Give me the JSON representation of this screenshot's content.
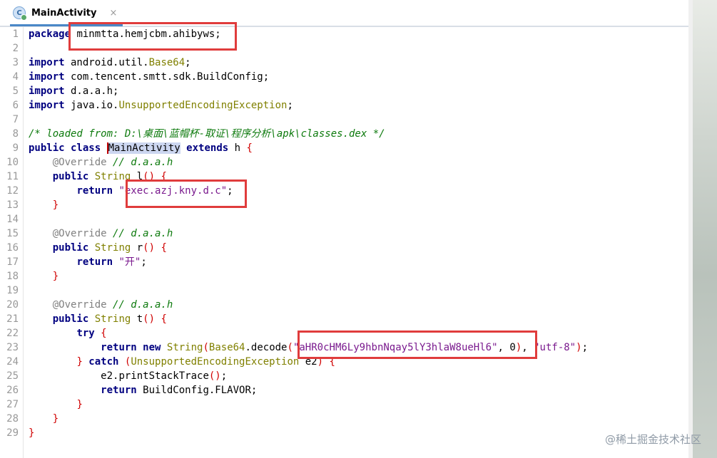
{
  "tab": {
    "icon": "class-c-icon",
    "title": "MainActivity",
    "close": "×"
  },
  "line_numbers": [
    "1",
    "2",
    "3",
    "4",
    "5",
    "6",
    "7",
    "8",
    "9",
    "10",
    "11",
    "12",
    "13",
    "14",
    "15",
    "16",
    "17",
    "18",
    "19",
    "20",
    "21",
    "22",
    "23",
    "24",
    "25",
    "26",
    "27",
    "28",
    "29"
  ],
  "code": {
    "l1": {
      "kw": "package",
      "rest": " minmtta.hemjcbm.ahibyws;"
    },
    "l3": {
      "kw": "import",
      "pkg": " android.util.",
      "cls": "Base64",
      "end": ";"
    },
    "l4": {
      "kw": "import",
      "rest": " com.tencent.smtt.sdk.BuildConfig;"
    },
    "l5": {
      "kw": "import",
      "rest": " d.a.a.h;"
    },
    "l6": {
      "kw": "import",
      "pkg": " java.io.",
      "cls": "UnsupportedEncodingException",
      "end": ";"
    },
    "l8": {
      "comment": "/* loaded from: D:\\桌面\\蓝帽杯-取证\\程序分析\\apk\\classes.dex */"
    },
    "l9": {
      "kw1": "public",
      "kw2": " class ",
      "name": "MainActivity",
      "kw3": " extends",
      "rest": " h ",
      "brace": "{"
    },
    "l10": {
      "ann": "@Override",
      "comment": " // d.a.a.h"
    },
    "l11": {
      "kw": "public",
      "type": " String",
      "name": " l",
      "paren": "()",
      "brace": " {"
    },
    "l12": {
      "kw": "return",
      "str": " \"exec.azj.kny.d.c\"",
      "end": ";"
    },
    "l13": {
      "brace": "}"
    },
    "l15": {
      "ann": "@Override",
      "comment": " // d.a.a.h"
    },
    "l16": {
      "kw": "public",
      "type": " String",
      "name": " r",
      "paren": "()",
      "brace": " {"
    },
    "l17": {
      "kw": "return",
      "str": " \"开\"",
      "end": ";"
    },
    "l18": {
      "brace": "}"
    },
    "l20": {
      "ann": "@Override",
      "comment": " // d.a.a.h"
    },
    "l21": {
      "kw": "public",
      "type": " String",
      "name": " t",
      "paren": "()",
      "brace": " {"
    },
    "l22": {
      "kw": "try",
      "brace": " {"
    },
    "l23": {
      "kw1": "return",
      "kw2": " new ",
      "type": "String",
      "p1": "(",
      "cls": "Base64",
      "method": ".decode",
      "p2": "(",
      "str": "\"aHR0cHM6Ly9hbnNqay5lY3hlaW8ueHl6\"",
      "arg": ", 0",
      "p3": ")",
      "comma": ", ",
      "str2": "\"utf-8\"",
      "p4": ")",
      "end": ";"
    },
    "l24": {
      "brace": "} ",
      "kw": "catch",
      "p1": " (",
      "cls": "UnsupportedEncodingException",
      "var": " e2",
      "p2": ")",
      "brace2": " {"
    },
    "l25": {
      "rest": "e2.printStackTrace",
      "paren": "()",
      "end": ";"
    },
    "l26": {
      "kw": "return",
      "rest": " BuildConfig.FLAVOR;"
    },
    "l27": {
      "brace": "}"
    },
    "l28": {
      "brace": "}"
    },
    "l29": {
      "brace": "}"
    }
  },
  "watermark": "@稀土掘金技术社区",
  "colors": {
    "highlight_box": "#e03c3c",
    "keyword": "#000080",
    "string": "#008000"
  }
}
